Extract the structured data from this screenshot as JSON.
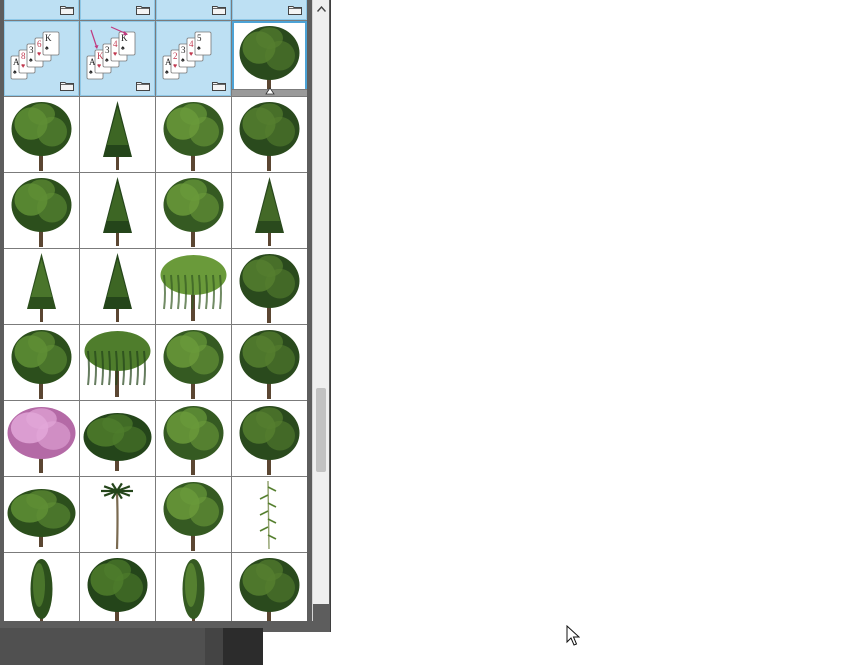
{
  "picker": {
    "tiles": [
      {
        "kind": "folder",
        "thumb": "card-partial"
      },
      {
        "kind": "folder",
        "thumb": "card-partial"
      },
      {
        "kind": "folder",
        "thumb": "card-partial"
      },
      {
        "kind": "folder",
        "thumb": "card-partial"
      },
      {
        "kind": "folder",
        "thumb": "solitaire-cards",
        "cards": [
          "A",
          "8",
          "3",
          "6",
          "K"
        ]
      },
      {
        "kind": "folder",
        "thumb": "solitaire-cards-arrows",
        "cards": [
          "A",
          "K",
          "3",
          "4",
          "K"
        ]
      },
      {
        "kind": "folder",
        "thumb": "solitaire-cards",
        "cards": [
          "A",
          "2",
          "3",
          "4",
          "5"
        ]
      },
      {
        "kind": "tree",
        "thumb": "tree-icon",
        "selected": true
      },
      {
        "kind": "tree",
        "thumb": "tree-icon"
      },
      {
        "kind": "tree",
        "thumb": "pine-icon"
      },
      {
        "kind": "tree",
        "thumb": "tree-icon"
      },
      {
        "kind": "tree",
        "thumb": "tree-icon"
      },
      {
        "kind": "tree",
        "thumb": "tree-icon"
      },
      {
        "kind": "tree",
        "thumb": "pine-icon"
      },
      {
        "kind": "tree",
        "thumb": "tree-icon"
      },
      {
        "kind": "tree",
        "thumb": "pine-icon"
      },
      {
        "kind": "tree",
        "thumb": "pine-icon"
      },
      {
        "kind": "tree",
        "thumb": "pine-icon"
      },
      {
        "kind": "tree",
        "thumb": "willow-icon"
      },
      {
        "kind": "tree",
        "thumb": "tree-icon"
      },
      {
        "kind": "tree",
        "thumb": "tree-icon"
      },
      {
        "kind": "tree",
        "thumb": "willow-icon"
      },
      {
        "kind": "tree",
        "thumb": "tree-icon"
      },
      {
        "kind": "tree",
        "thumb": "tree-icon"
      },
      {
        "kind": "tree",
        "thumb": "blossom-tree-icon"
      },
      {
        "kind": "tree",
        "thumb": "bush-icon"
      },
      {
        "kind": "tree",
        "thumb": "tree-icon"
      },
      {
        "kind": "tree",
        "thumb": "tree-icon"
      },
      {
        "kind": "tree",
        "thumb": "bush-icon"
      },
      {
        "kind": "tree",
        "thumb": "palm-icon"
      },
      {
        "kind": "tree",
        "thumb": "tree-icon"
      },
      {
        "kind": "tree",
        "thumb": "bamboo-icon"
      },
      {
        "kind": "tree",
        "thumb": "cypress-icon"
      },
      {
        "kind": "tree",
        "thumb": "tree-icon"
      },
      {
        "kind": "tree",
        "thumb": "cypress-icon"
      },
      {
        "kind": "tree",
        "thumb": "tree-icon"
      }
    ]
  },
  "scrollbar": {
    "position_fraction": 0.62
  },
  "colors": {
    "folder_bg": "#bde0f3",
    "panel_bg": "#5d5d5d",
    "tree_green": "#3f6b22",
    "tree_dark": "#24451a",
    "blossom": "#d48ec6"
  }
}
